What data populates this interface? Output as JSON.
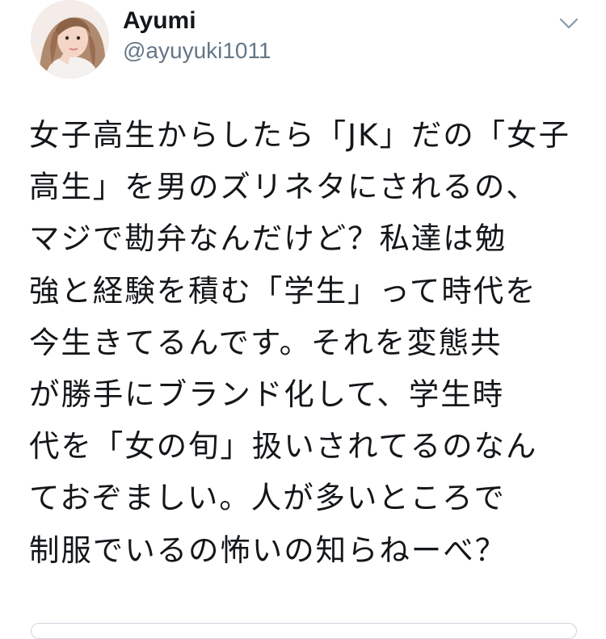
{
  "tweet": {
    "author": {
      "display_name": "Ayumi",
      "handle": "@ayuyuki1011",
      "avatar_icon": "profile-photo"
    },
    "menu_icon": "chevron-down-icon",
    "text_lines": [
      "女子高生からしたら「JK」だの「女子",
      "高生」を男のズリネタにされるの、",
      "マジで勘弁なんだけど？私達は勉",
      "強と経験を積む「学生」って時代を",
      "今生きてるんです。それを変態共",
      "が勝手にブランド化して、学生時",
      "代を「女の旬」扱いされてるのなん",
      "ておぞましい。人が多いところで",
      "制服でいるの怖いの知らねーべ？"
    ],
    "colors": {
      "text": "#14171a",
      "secondary": "#657786",
      "border": "#ccd6dd"
    }
  }
}
